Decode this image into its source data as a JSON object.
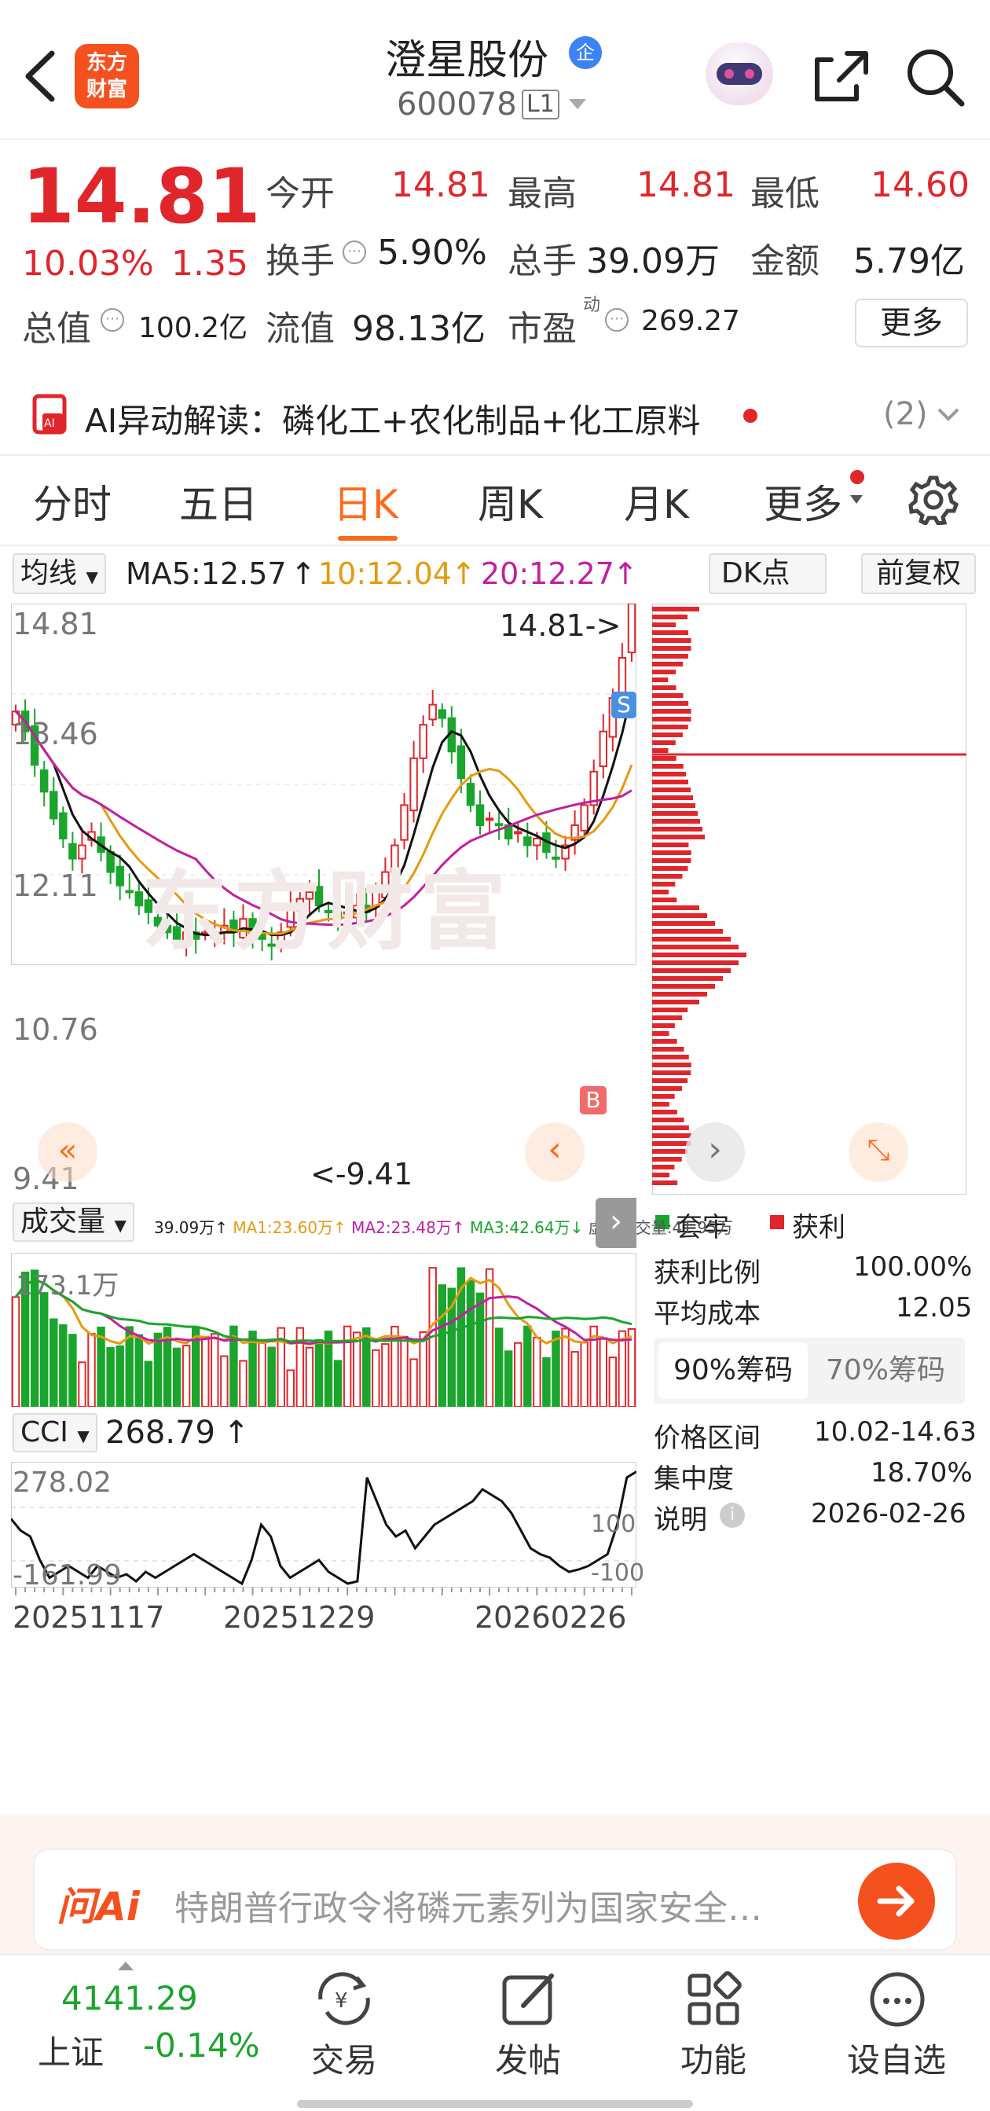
{
  "header": {
    "title": "澄星股份",
    "code": "600078",
    "level": "L1",
    "logo_line1": "东方",
    "logo_line2": "财富",
    "badge": "企"
  },
  "quote": {
    "price": "14.81",
    "change_pct": "10.03%",
    "change": "1.35",
    "open_label": "今开",
    "open": "14.81",
    "high_label": "最高",
    "high": "14.81",
    "low_label": "最低",
    "low": "14.60",
    "turnover_label": "换手",
    "turnover": "5.90%",
    "vol_label": "总手",
    "vol": "39.09万",
    "amount_label": "金额",
    "amount": "5.79亿",
    "mktcap_label": "总值",
    "mktcap": "100.2亿",
    "float_label": "流值",
    "float": "98.13亿",
    "pe_label": "市盈",
    "pe_sup": "动",
    "pe": "269.27",
    "more": "更多"
  },
  "ai_bar": {
    "text": "AI异动解读：磷化工+农化制品+化工原料",
    "count": "(2)"
  },
  "tabs": [
    "分时",
    "五日",
    "日K",
    "周K",
    "月K",
    "更多"
  ],
  "active_tab": "日K",
  "kline": {
    "ma_select": "均线",
    "ma5": "MA5:12.57",
    "ma10": "10:12.04",
    "ma20": "20:12.27",
    "dk": "DK点",
    "adjust": "前复权",
    "top_price": "14.81",
    "p2": "13.46",
    "p3": "12.11",
    "p4": "10.76",
    "bottom_price": "9.41",
    "max_label": "14.81->",
    "min_label": "<-9.41",
    "s_mark": "S",
    "b_mark": "B",
    "watermark": "东方财富"
  },
  "volume": {
    "select": "成交量",
    "v": "39.09万",
    "ma1": "MA1:23.60万",
    "ma2": "MA2:23.48万",
    "ma3": "MA3:42.64万",
    "virtual": "虚拟成交量:41.95万",
    "max": "173.1万"
  },
  "cci": {
    "select": "CCI",
    "value": "268.79",
    "top": "278.02",
    "bottom": "-161.99",
    "l100": "100",
    "lm100": "-100"
  },
  "dates": [
    "20251117",
    "20251229",
    "20260226"
  ],
  "chips": {
    "legend_hold": "套牢",
    "legend_profit": "获利",
    "profit_ratio_label": "获利比例",
    "profit_ratio": "100.00%",
    "avg_cost_label": "平均成本",
    "avg_cost": "12.05",
    "tab90": "90%筹码",
    "tab70": "70%筹码",
    "range_label": "价格区间",
    "range": "10.02-14.63",
    "conc_label": "集中度",
    "conc": "18.70%",
    "note_label": "说明",
    "note": "2026-02-26"
  },
  "ask_ai": {
    "logo": "问Ai",
    "text": "特朗普行政令将磷元素列为国家安全…"
  },
  "nav": {
    "index_value": "4141.29",
    "index_name": "上证",
    "index_change": "-0.14%",
    "trade": "交易",
    "post": "发帖",
    "func": "功能",
    "watch": "设自选"
  },
  "colors": {
    "up": "#e0262b",
    "down": "#1aa52c",
    "accent": "#ff6a1a"
  },
  "chart_data": {
    "type": "candlestick",
    "y_range": [
      9.41,
      14.81
    ],
    "last_close": 14.81,
    "ma5": 12.57,
    "ma10": 12.04,
    "ma20": 12.27,
    "high_max": 14.81,
    "low_min": 9.41
  }
}
